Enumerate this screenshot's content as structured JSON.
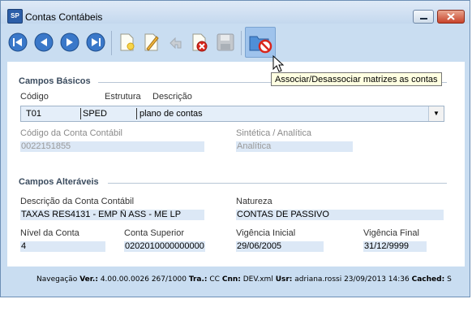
{
  "window": {
    "title": "Contas Contábeis",
    "app_icon_text": "SP"
  },
  "toolbar": {
    "buttons": [
      {
        "name": "first-record",
        "icon": "skip-first-icon"
      },
      {
        "name": "previous-record",
        "icon": "prev-icon"
      },
      {
        "name": "next-record",
        "icon": "next-icon"
      },
      {
        "name": "last-record",
        "icon": "skip-last-icon"
      },
      {
        "name": "new-record",
        "icon": "new-document-icon"
      },
      {
        "name": "edit-record",
        "icon": "pencil-icon"
      },
      {
        "name": "undo",
        "icon": "undo-arrow-icon"
      },
      {
        "name": "delete-record",
        "icon": "delete-document-icon"
      },
      {
        "name": "save-record",
        "icon": "floppy-disk-icon"
      },
      {
        "name": "associate-matrices",
        "icon": "folder-forbidden-icon"
      }
    ],
    "tooltip": "Associar/Desassociar matrizes as contas"
  },
  "campos_basicos": {
    "title": "Campos Básicos",
    "codigo_label": "Código",
    "estrutura_label": "Estrutura",
    "descricao_label": "Descrição",
    "codigo": "T01",
    "estrutura": "SPED",
    "descricao": "plano de contas",
    "codigo_conta_label": "Código da Conta Contábil",
    "codigo_conta": "0022151855",
    "sintetica_label": "Sintética / Analítica",
    "sintetica": "Analítica"
  },
  "campos_alteraveis": {
    "title": "Campos Alteráveis",
    "descricao_conta_label": "Descrição da Conta Contábil",
    "descricao_conta": "TAXAS RES4131 - EMP Ñ ASS - ME LP",
    "natureza_label": "Natureza",
    "natureza": "CONTAS DE PASSIVO",
    "nivel_label": "Nível da Conta",
    "nivel": "4",
    "conta_superior_label": "Conta Superior",
    "conta_superior": "0202010000000000",
    "vig_inicial_label": "Vigência Inicial",
    "vig_inicial": "29/06/2005",
    "vig_final_label": "Vigência Final",
    "vig_final": "31/12/9999"
  },
  "status": {
    "mode": "Navegação",
    "ver_label": "Ver.:",
    "ver": "4.00.00.0026",
    "record": "267/1000",
    "tra_label": "Tra.:",
    "tra": "CC",
    "cnn_label": "Cnn:",
    "cnn": "DEV.xml",
    "usr_label": "Usr:",
    "usr": "adriana.rossi",
    "datetime": "23/09/2013  14:36",
    "cached_label": "Cached:",
    "cached": "S"
  },
  "colors": {
    "field_bg": "#dce8f6",
    "frame": "#c9ddf1",
    "tooltip_bg": "#ffffe1"
  }
}
